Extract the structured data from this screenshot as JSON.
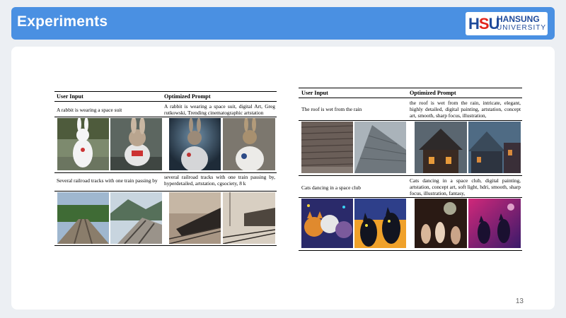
{
  "slide": {
    "title": "Experiments",
    "logo": {
      "mark_left": "H",
      "mark_mid": "S",
      "mark_right": "U",
      "name": "HANSUNG",
      "sub": "UNIVERSITY"
    },
    "page_number": "13"
  },
  "left_table": {
    "headers": {
      "input": "User Input",
      "prompt": "Optimized Prompt"
    },
    "rows": [
      {
        "input": "A rabbit is wearing a space suit",
        "prompt": "A rabbit is wearing a space suit, digital Art, Greg rutkowski, Trending cinematographic artstation",
        "images": [
          "rabbit-snow",
          "rabbit-astronaut-toy",
          "rabbit-astronaut-dark",
          "rabbit-astronaut-white"
        ]
      },
      {
        "input": "Several railroad tracks with one train passing by",
        "prompt": "several railroad tracks with one train passing by, hyperdetailed, artstation, cgsociety, 8 k",
        "images": [
          "tracks-forest",
          "tracks-mountain",
          "train-dark",
          "train-station"
        ]
      }
    ]
  },
  "right_table": {
    "headers": {
      "input": "User Input",
      "prompt": "Optimized Prompt"
    },
    "rows": [
      {
        "input": "The roof is wet from the rain",
        "prompt": "the roof is wet from the rain, intricate, elegant, highly detailed, digital painting, artstation, concept art, smooth, sharp focus, illustration,",
        "images": [
          "roof-shingles",
          "roof-slate",
          "roof-house-night",
          "roof-rain-town"
        ]
      },
      {
        "input": "Cats dancing in a space club",
        "prompt": "Cats dancing in a space club, digital painting, artstation, concept art, soft light, hdri, smooth, sharp focus, illustration, fantasy,",
        "images": [
          "cats-colorful",
          "cats-silhouette",
          "cats-club-dark",
          "cats-space-purple"
        ]
      }
    ]
  }
}
